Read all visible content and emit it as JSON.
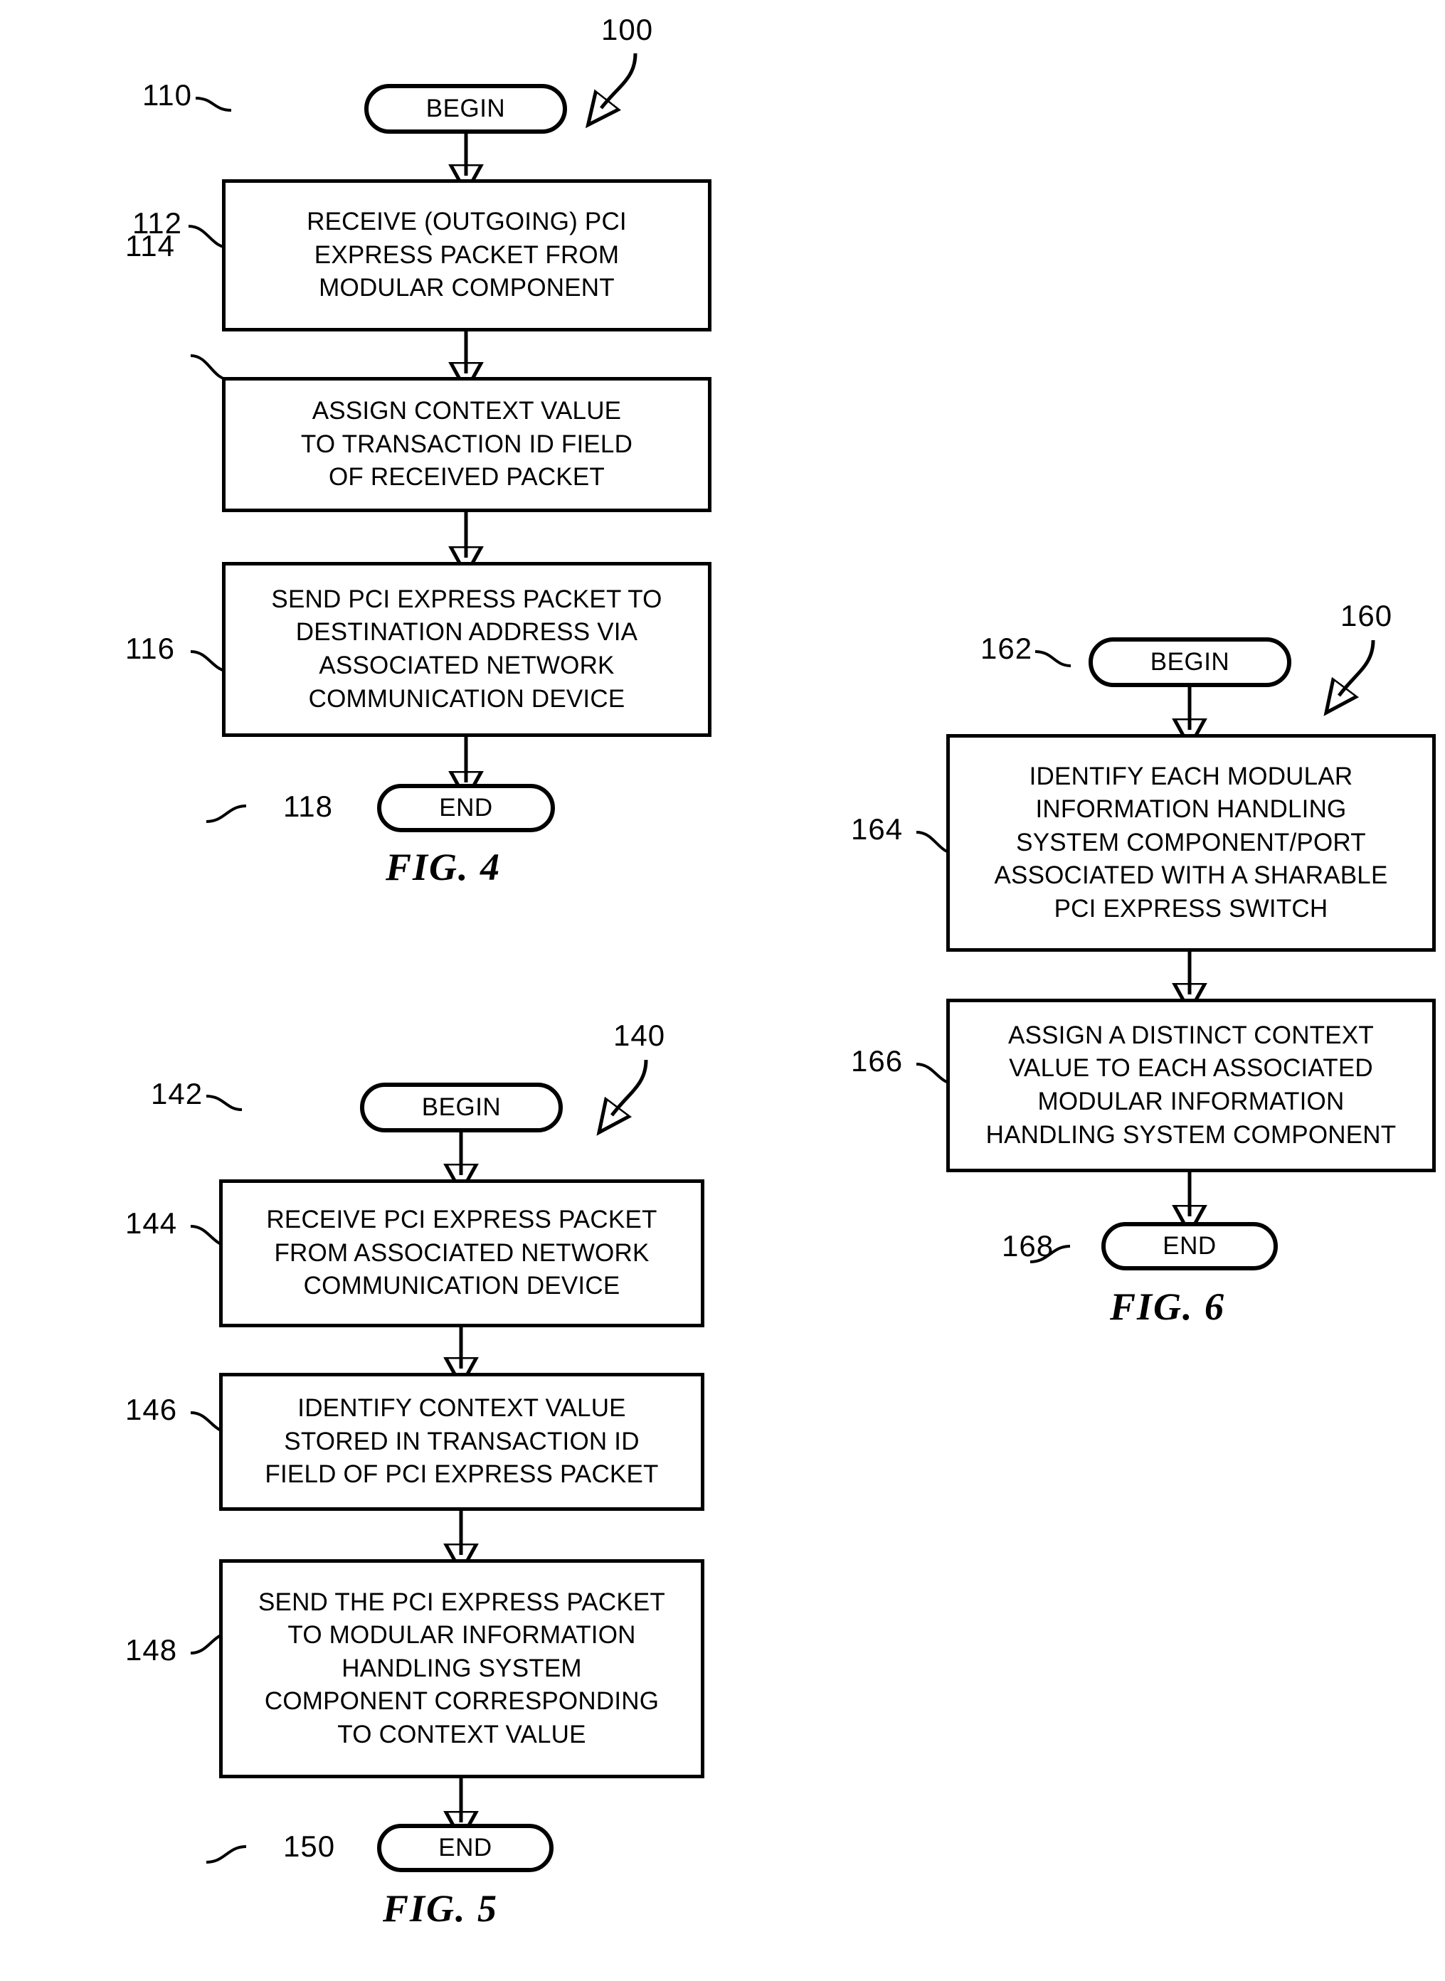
{
  "figures": [
    {
      "id": "fig4",
      "caption": "FIG. 4",
      "flow_ref": "100",
      "nodes": {
        "begin": {
          "ref": "110",
          "label": "BEGIN"
        },
        "step1": {
          "ref": "112",
          "lines": [
            "RECEIVE (OUTGOING) PCI",
            "EXPRESS PACKET FROM",
            "MODULAR COMPONENT"
          ]
        },
        "step2": {
          "ref": "114",
          "lines": [
            "ASSIGN CONTEXT VALUE",
            "TO TRANSACTION ID FIELD",
            "OF RECEIVED PACKET"
          ]
        },
        "step3": {
          "ref": "116",
          "lines": [
            "SEND PCI EXPRESS PACKET TO",
            "DESTINATION ADDRESS VIA",
            "ASSOCIATED NETWORK",
            "COMMUNICATION DEVICE"
          ]
        },
        "end": {
          "ref": "118",
          "label": "END"
        }
      }
    },
    {
      "id": "fig5",
      "caption": "FIG. 5",
      "flow_ref": "140",
      "nodes": {
        "begin": {
          "ref": "142",
          "label": "BEGIN"
        },
        "step1": {
          "ref": "144",
          "lines": [
            "RECEIVE PCI EXPRESS PACKET",
            "FROM ASSOCIATED NETWORK",
            "COMMUNICATION DEVICE"
          ]
        },
        "step2": {
          "ref": "146",
          "lines": [
            "IDENTIFY CONTEXT VALUE",
            "STORED IN TRANSACTION ID",
            "FIELD OF PCI EXPRESS PACKET"
          ]
        },
        "step3": {
          "ref": "148",
          "lines": [
            "SEND THE PCI EXPRESS PACKET",
            "TO MODULAR INFORMATION",
            "HANDLING SYSTEM",
            "COMPONENT CORRESPONDING",
            "TO CONTEXT VALUE"
          ]
        },
        "end": {
          "ref": "150",
          "label": "END"
        }
      }
    },
    {
      "id": "fig6",
      "caption": "FIG. 6",
      "flow_ref": "160",
      "nodes": {
        "begin": {
          "ref": "162",
          "label": "BEGIN"
        },
        "step1": {
          "ref": "164",
          "lines": [
            "IDENTIFY EACH MODULAR",
            "INFORMATION HANDLING",
            "SYSTEM COMPONENT/PORT",
            "ASSOCIATED WITH A SHARABLE",
            "PCI EXPRESS SWITCH"
          ]
        },
        "step2": {
          "ref": "166",
          "lines": [
            "ASSIGN A DISTINCT CONTEXT",
            "VALUE TO EACH ASSOCIATED",
            "MODULAR INFORMATION",
            "HANDLING SYSTEM COMPONENT"
          ]
        },
        "end": {
          "ref": "168",
          "label": "END"
        }
      }
    }
  ],
  "colors": {
    "ink": "#000000",
    "paper": "#ffffff"
  }
}
